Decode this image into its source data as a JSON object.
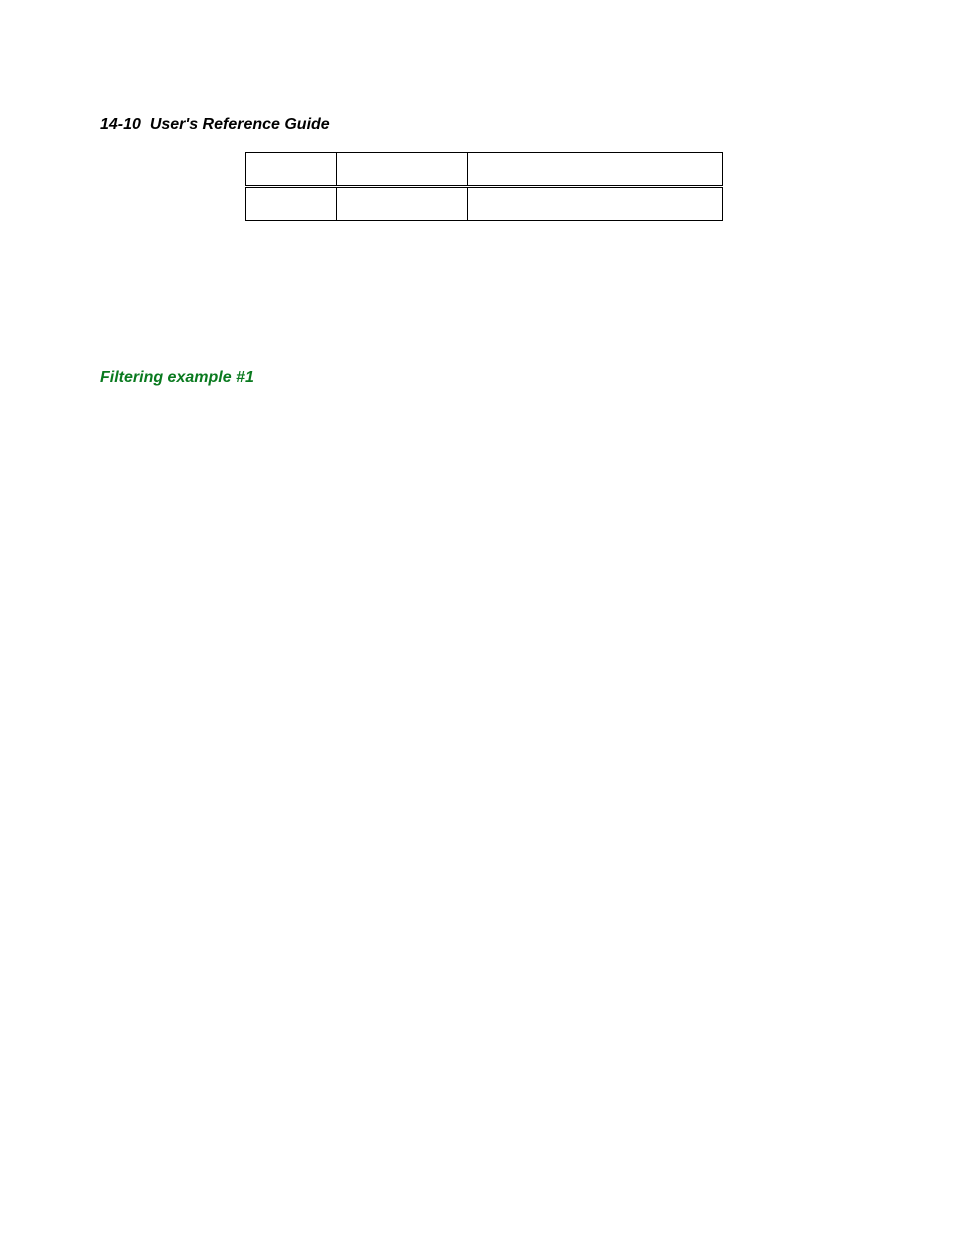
{
  "header": {
    "page_number": "14-10",
    "title": "User's Reference Guide"
  },
  "table": {
    "headers": [
      "",
      "",
      ""
    ],
    "rows": [
      [
        "",
        "",
        ""
      ]
    ]
  },
  "section": {
    "heading": "Filtering example #1"
  }
}
